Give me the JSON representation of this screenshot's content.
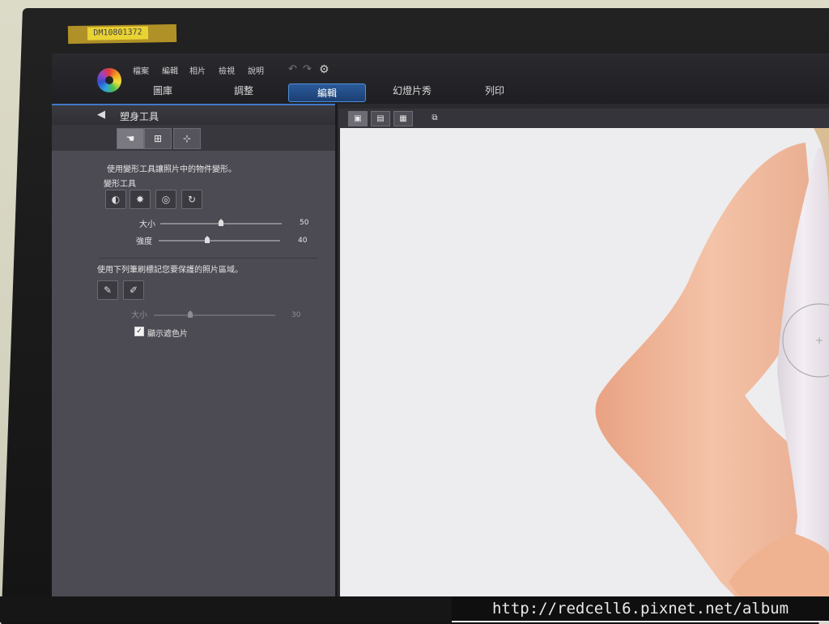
{
  "tape_label": "DM10801372",
  "app": {
    "menu": [
      "檔案",
      "編輯",
      "相片",
      "檢視",
      "說明"
    ],
    "mode_tabs": [
      "圖庫",
      "調整",
      "編輯",
      "幻燈片秀",
      "列印"
    ],
    "active_mode": "編輯"
  },
  "panel": {
    "title": "塑身工具",
    "subtabs": [
      "reshape-hand-icon",
      "grid-icon",
      "crop-frame-icon"
    ],
    "description": "使用變形工具讓照片中的物件變形。",
    "warp_section_label": "變形工具",
    "warp_tools": [
      "warp-push-icon",
      "bloat-icon",
      "pinch-icon",
      "twirl-icon"
    ],
    "size_label": "大小",
    "size_value": "50",
    "size_level": 0.5,
    "strength_label": "強度",
    "strength_value": "40",
    "strength_level": 0.4,
    "protect_description": "使用下列筆刷標記您要保護的照片區域。",
    "brush_tools": [
      "brush-add-icon",
      "brush-erase-icon"
    ],
    "brush_size_label": "大小",
    "brush_size_value": "30",
    "brush_size_level": 0.3,
    "show_mask_label": "顯示遮色片",
    "show_mask_checked": true
  },
  "canvas": {
    "view_buttons": [
      "single-view-icon",
      "compare-view-icon",
      "thumbnail-grid-icon",
      "dual-monitor-icon"
    ]
  },
  "watermark": "http://redcell6.pixnet.net/album",
  "colors": {
    "accent": "#3f78c8",
    "panel_bg": "#4c4b54",
    "canvas_bg": "#ececee",
    "skin": "#f0b89b",
    "dress": "#ece6ec"
  }
}
